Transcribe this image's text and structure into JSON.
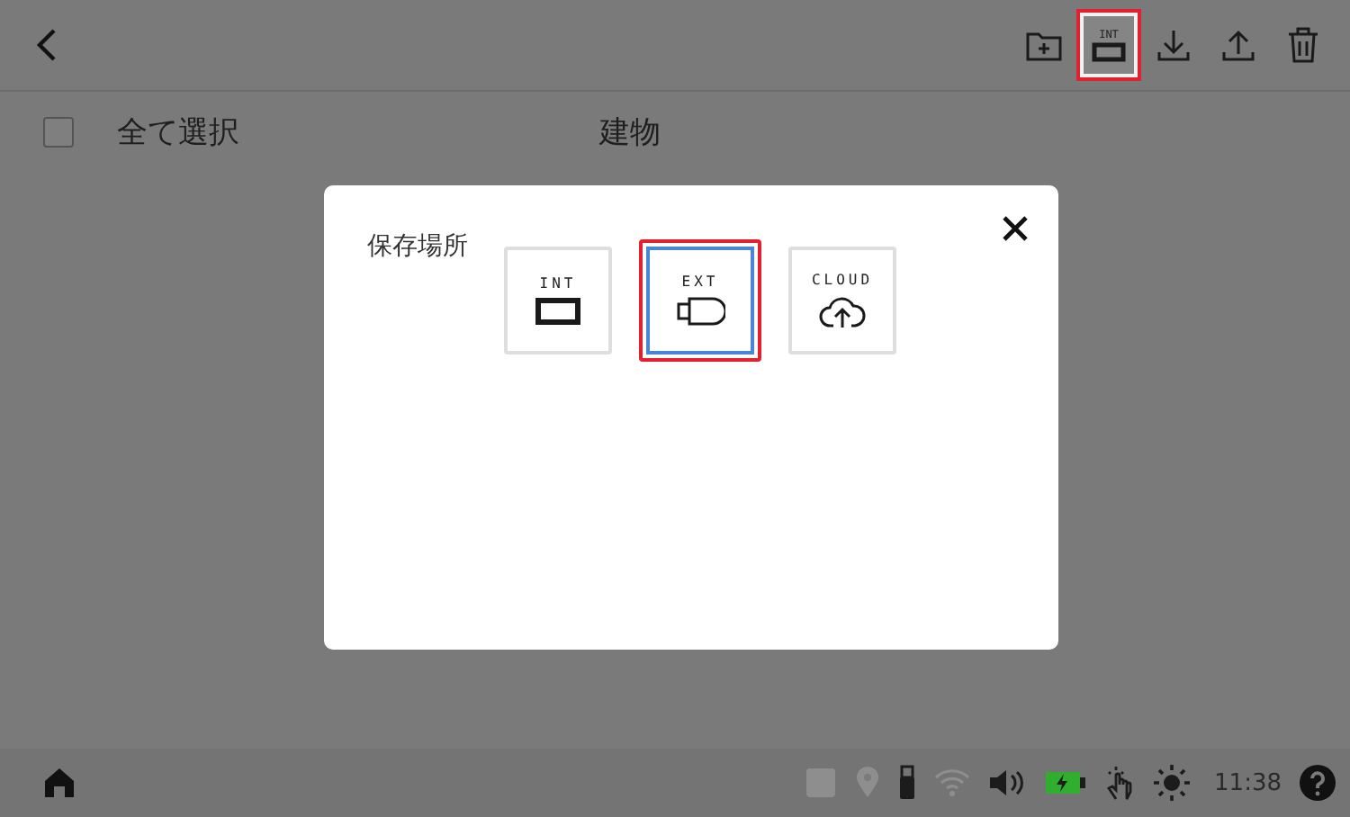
{
  "header": {
    "toolbar": [
      {
        "kind": "new-folder",
        "highlighted": false
      },
      {
        "kind": "storage",
        "label": "INT",
        "highlighted": true
      },
      {
        "kind": "download",
        "highlighted": false
      },
      {
        "kind": "upload",
        "highlighted": false
      },
      {
        "kind": "delete",
        "highlighted": false
      }
    ]
  },
  "list_header": {
    "select_all": {
      "label": "全て選択",
      "checked": false
    },
    "column": "建物"
  },
  "dialog": {
    "label": "保存場所",
    "options": [
      {
        "kind": "int",
        "label": "INT",
        "selected": false,
        "highlighted": false
      },
      {
        "kind": "ext",
        "label": "EXT",
        "selected": true,
        "highlighted": true
      },
      {
        "kind": "cloud",
        "label": "CLOUD",
        "selected": false,
        "highlighted": false
      }
    ]
  },
  "status_bar": {
    "icons": [
      {
        "kind": "lte",
        "enabled": false
      },
      {
        "kind": "location",
        "enabled": false
      },
      {
        "kind": "usb",
        "enabled": true
      },
      {
        "kind": "wifi",
        "enabled": false
      },
      {
        "kind": "volume",
        "enabled": true
      },
      {
        "kind": "battery",
        "enabled": true
      },
      {
        "kind": "touch",
        "enabled": true
      },
      {
        "kind": "brightness",
        "enabled": true
      }
    ],
    "time": "11:38"
  }
}
